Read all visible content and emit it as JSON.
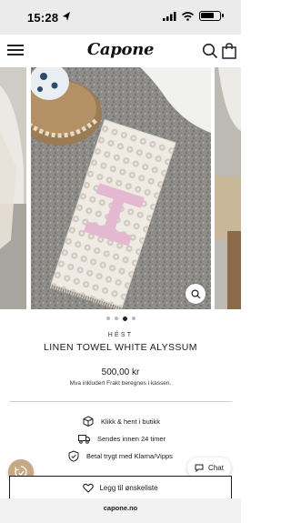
{
  "status_bar": {
    "time": "15:28"
  },
  "header": {
    "logo": "Capone"
  },
  "gallery": {
    "current_slide": 3,
    "total_slides": 4
  },
  "product": {
    "brand": "HÉST",
    "title": "LINEN TOWEL WHITE ALYSSUM",
    "price": "500,00 kr",
    "tax_note": "Mva inkludert Frakt beregnes i kassen."
  },
  "features": [
    {
      "icon": "box-icon",
      "label": "Klikk & hent i butikk"
    },
    {
      "icon": "truck-icon",
      "label": "Sendes innen 24 timer"
    },
    {
      "icon": "shield-check-icon",
      "label": "Betal trygt med Klarna/Vipps"
    }
  ],
  "actions": {
    "wishlist_label": "Legg til ønskeliste",
    "chat_label": "Chat"
  },
  "browser": {
    "url": "capone.no"
  },
  "colors": {
    "accent_badge": "#c8a784",
    "text": "#1a1a1a",
    "towel_motif": "#e3b8d0"
  }
}
